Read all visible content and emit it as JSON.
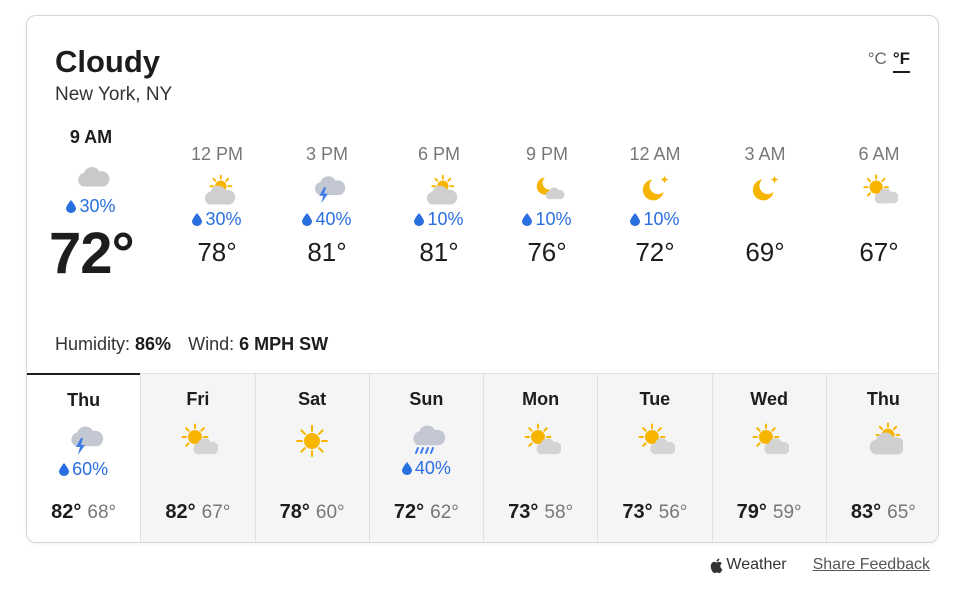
{
  "current": {
    "condition": "Cloudy",
    "location": "New York, NY",
    "unit_c": "°C",
    "unit_f": "°F",
    "humidity_label": "Humidity:",
    "humidity_value": "86%",
    "wind_label": "Wind:",
    "wind_value": "6 MPH SW"
  },
  "hourly": [
    {
      "time": "9 AM",
      "icon": "cloud-icon",
      "precip": "30%",
      "temp": "72°"
    },
    {
      "time": "12 PM",
      "icon": "partly-sunny-icon",
      "precip": "30%",
      "temp": "78°"
    },
    {
      "time": "3 PM",
      "icon": "thunderstorm-icon",
      "precip": "40%",
      "temp": "81°"
    },
    {
      "time": "6 PM",
      "icon": "partly-sunny-icon",
      "precip": "10%",
      "temp": "81°"
    },
    {
      "time": "9 PM",
      "icon": "moon-cloud-icon",
      "precip": "10%",
      "temp": "76°"
    },
    {
      "time": "12 AM",
      "icon": "moon-star-icon",
      "precip": "10%",
      "temp": "72°"
    },
    {
      "time": "3 AM",
      "icon": "moon-star-icon",
      "precip": "",
      "temp": "69°"
    },
    {
      "time": "6 AM",
      "icon": "sun-cloud-icon",
      "precip": "",
      "temp": "67°"
    }
  ],
  "daily": [
    {
      "day": "Thu",
      "icon": "thunderstorm-icon",
      "precip": "60%",
      "high": "82°",
      "low": "68°"
    },
    {
      "day": "Fri",
      "icon": "sun-cloud-icon",
      "precip": "",
      "high": "82°",
      "low": "67°"
    },
    {
      "day": "Sat",
      "icon": "sun-icon",
      "precip": "",
      "high": "78°",
      "low": "60°"
    },
    {
      "day": "Sun",
      "icon": "rain-icon",
      "precip": "40%",
      "high": "72°",
      "low": "62°"
    },
    {
      "day": "Mon",
      "icon": "sun-cloud-icon",
      "precip": "",
      "high": "73°",
      "low": "58°"
    },
    {
      "day": "Tue",
      "icon": "sun-cloud-icon",
      "precip": "",
      "high": "73°",
      "low": "56°"
    },
    {
      "day": "Wed",
      "icon": "sun-cloud-icon",
      "precip": "",
      "high": "79°",
      "low": "59°"
    },
    {
      "day": "Thu",
      "icon": "cloud-sun-behind-icon",
      "precip": "",
      "high": "83°",
      "low": "65°"
    }
  ],
  "footer": {
    "brand": "Weather",
    "feedback": "Share Feedback"
  },
  "colors": {
    "precip_blue": "#2a6fe0",
    "sun_yellow": "#f7b500",
    "cloud_gray": "#c9c9c9"
  }
}
